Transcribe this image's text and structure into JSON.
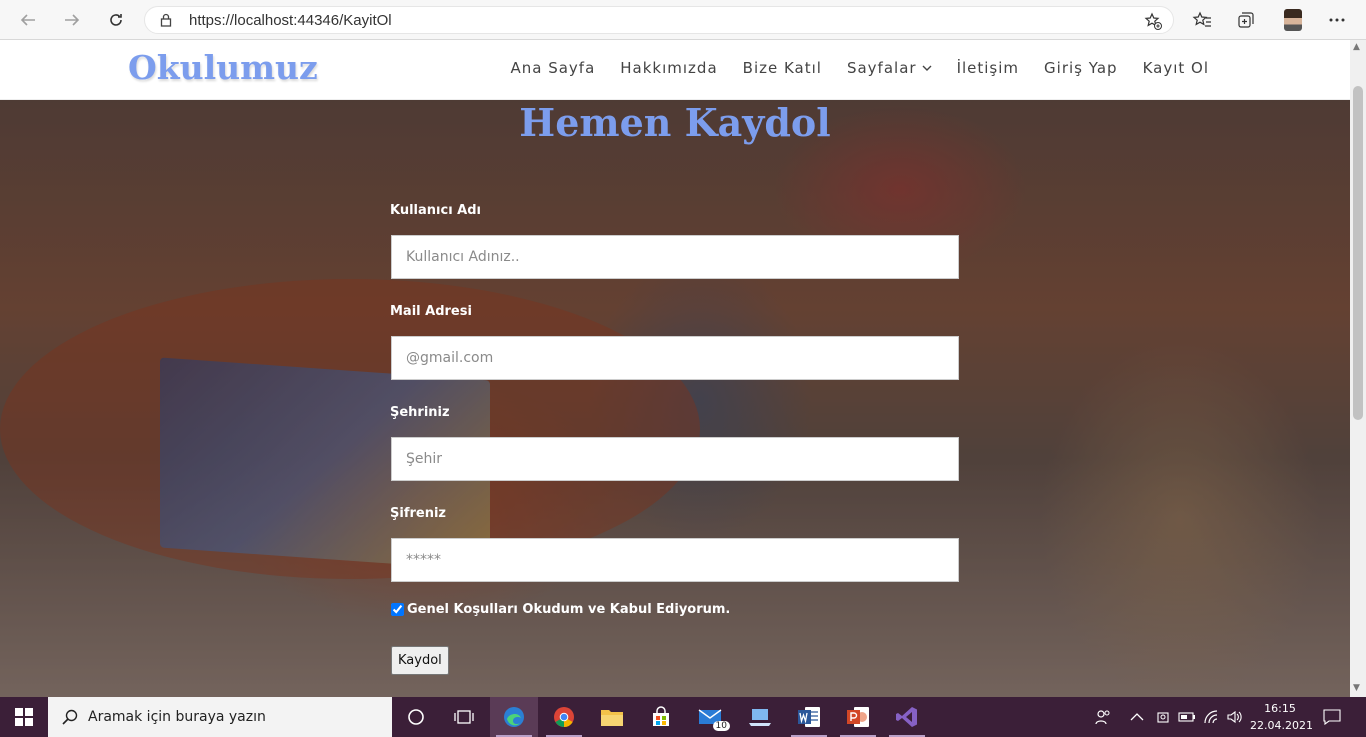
{
  "browser": {
    "url": "https://localhost:44346/KayitOl",
    "icons": [
      "back-arrow-icon",
      "forward-arrow-icon",
      "refresh-icon",
      "lock-icon",
      "add-favorite-icon",
      "favorites-icon",
      "collections-icon",
      "profile-avatar",
      "more-menu-icon"
    ]
  },
  "site": {
    "brand": "Okulumuz",
    "nav": [
      {
        "label": "Ana Sayfa"
      },
      {
        "label": "Hakkımızda"
      },
      {
        "label": "Bize Katıl"
      },
      {
        "label": "Sayfalar"
      },
      {
        "label": "İletişim"
      },
      {
        "label": "Giriş Yap"
      },
      {
        "label": "Kayıt Ol"
      }
    ],
    "accent_color": "#7c9ded"
  },
  "form": {
    "title": "Hemen Kaydol",
    "username_label": "Kullanıcı Adı",
    "username_placeholder": "Kullanıcı Adınız..",
    "email_label": "Mail Adresi",
    "email_placeholder": "@gmail.com",
    "city_label": "Şehriniz",
    "city_placeholder": "Şehir",
    "password_label": "Şifreniz",
    "password_placeholder": "*****",
    "terms_label": "Genel Koşulları Okudum ve Kabul Ediyorum.",
    "terms_checked": true,
    "submit_label": "Kaydol"
  },
  "taskbar": {
    "search_placeholder": "Aramak için buraya yazın",
    "mail_badge": "10",
    "time": "16:15",
    "date": "22.04.2021"
  }
}
